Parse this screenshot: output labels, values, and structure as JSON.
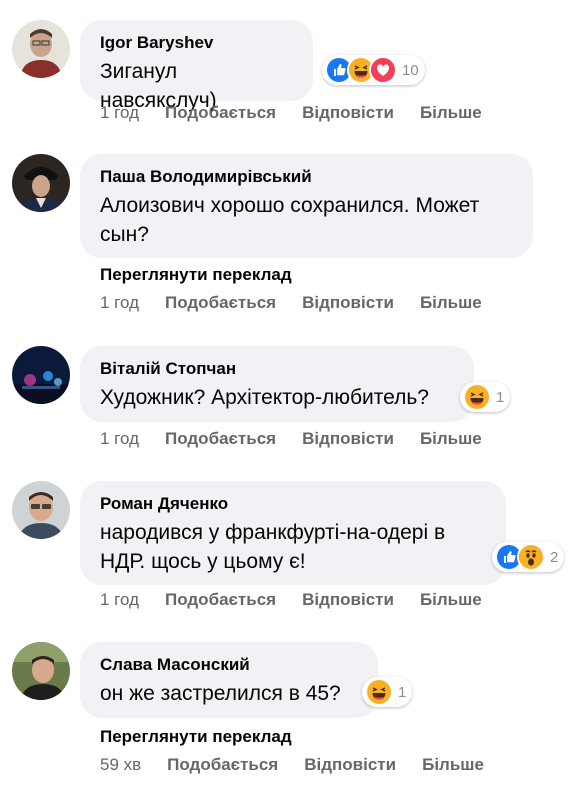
{
  "comments": [
    {
      "author": "Igor Baryshev",
      "text": "Зиганул навсякслуч)",
      "reaction_count": "10",
      "time": "1 год",
      "like": "Подобається",
      "reply": "Відповісти",
      "more": "Більше"
    },
    {
      "author": "Паша Володимирівський",
      "text": "Алоизович хорошо сохранился. Может сын?",
      "translate": "Переглянути переклад",
      "time": "1 год",
      "like": "Подобається",
      "reply": "Відповісти",
      "more": "Більше"
    },
    {
      "author": "Віталій Стопчан",
      "text": "Художник? Архітектор-любитель?",
      "reaction_count": "1",
      "time": "1 год",
      "like": "Подобається",
      "reply": "Відповісти",
      "more": "Більше"
    },
    {
      "author": "Роман Дяченко",
      "text": "народився у франкфурті-на-одері в НДР. щось у цьому є!",
      "reaction_count": "2",
      "time": "1 год",
      "like": "Подобається",
      "reply": "Відповісти",
      "more": "Більше"
    },
    {
      "author": "Слава Масонский",
      "text": "он же застрелился в 45?",
      "reaction_count": "1",
      "translate": "Переглянути переклад",
      "time": "59 хв",
      "like": "Подобається",
      "reply": "Відповісти",
      "more": "Більше"
    }
  ],
  "colors": {
    "bubble": "#f0f2f5",
    "meta_text": "#65676b",
    "like_blue": "#1877f2",
    "love_red": "#f33e58",
    "haha_yellow": "#f7b125"
  },
  "icons": [
    "like-reaction-icon",
    "haha-reaction-icon",
    "love-reaction-icon",
    "wow-reaction-icon"
  ]
}
